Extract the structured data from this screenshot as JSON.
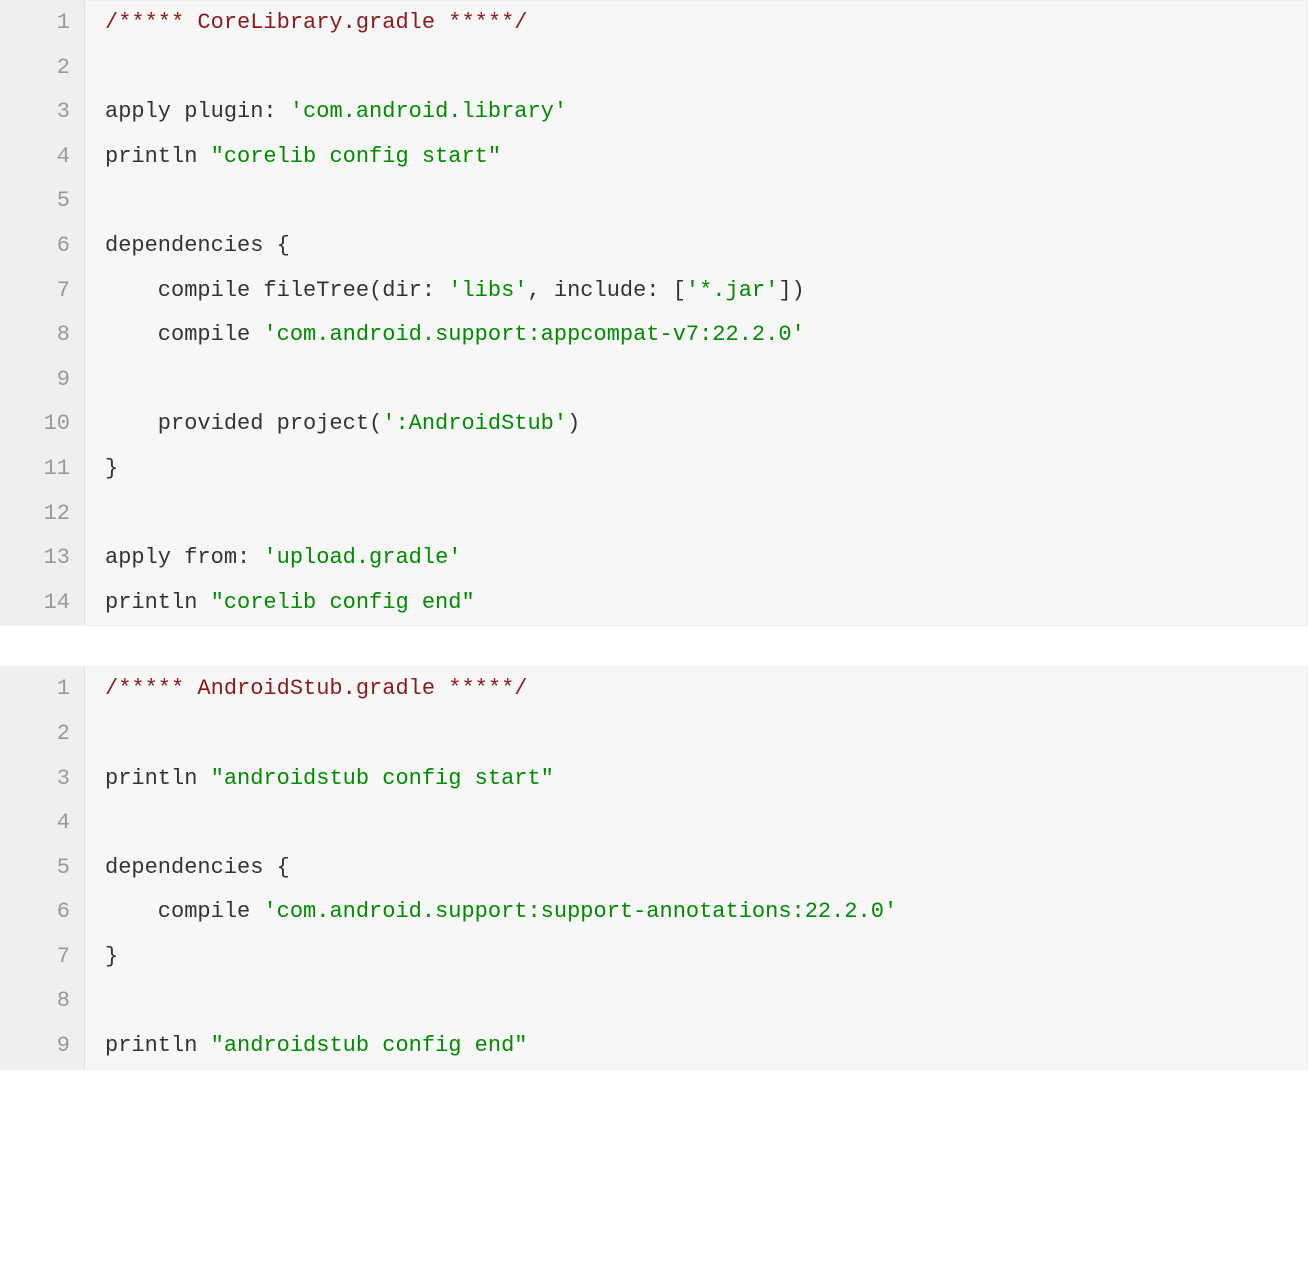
{
  "blocks": [
    {
      "lines": [
        [
          {
            "cls": "c-comment",
            "t": "/***** CoreLibrary.gradle *****/"
          }
        ],
        [],
        [
          {
            "cls": "c-plain",
            "t": "apply plugin: "
          },
          {
            "cls": "c-string",
            "t": "'com.android.library'"
          }
        ],
        [
          {
            "cls": "c-plain",
            "t": "println "
          },
          {
            "cls": "c-string",
            "t": "\"corelib config start\""
          }
        ],
        [],
        [
          {
            "cls": "c-plain",
            "t": "dependencies {"
          }
        ],
        [
          {
            "cls": "c-plain",
            "t": "    compile fileTree(dir: "
          },
          {
            "cls": "c-string",
            "t": "'libs'"
          },
          {
            "cls": "c-plain",
            "t": ", include: ["
          },
          {
            "cls": "c-string",
            "t": "'*.jar'"
          },
          {
            "cls": "c-plain",
            "t": "])"
          }
        ],
        [
          {
            "cls": "c-plain",
            "t": "    compile "
          },
          {
            "cls": "c-string",
            "t": "'com.android.support:appcompat-v7:22.2.0'"
          }
        ],
        [],
        [
          {
            "cls": "c-plain",
            "t": "    provided project("
          },
          {
            "cls": "c-string",
            "t": "':AndroidStub'"
          },
          {
            "cls": "c-plain",
            "t": ")"
          }
        ],
        [
          {
            "cls": "c-plain",
            "t": "}"
          }
        ],
        [],
        [
          {
            "cls": "c-plain",
            "t": "apply from: "
          },
          {
            "cls": "c-string",
            "t": "'upload.gradle'"
          }
        ],
        [
          {
            "cls": "c-plain",
            "t": "println "
          },
          {
            "cls": "c-string",
            "t": "\"corelib config end\""
          }
        ]
      ]
    },
    {
      "lines": [
        [
          {
            "cls": "c-comment",
            "t": "/***** AndroidStub.gradle *****/"
          }
        ],
        [],
        [
          {
            "cls": "c-plain",
            "t": "println "
          },
          {
            "cls": "c-string",
            "t": "\"androidstub config start\""
          }
        ],
        [],
        [
          {
            "cls": "c-plain",
            "t": "dependencies {"
          }
        ],
        [
          {
            "cls": "c-plain",
            "t": "    compile "
          },
          {
            "cls": "c-string",
            "t": "'com.android.support:support-annotations:22.2.0'"
          }
        ],
        [
          {
            "cls": "c-plain",
            "t": "}"
          }
        ],
        [],
        [
          {
            "cls": "c-plain",
            "t": "println "
          },
          {
            "cls": "c-string",
            "t": "\"androidstub config end\""
          }
        ]
      ]
    }
  ]
}
